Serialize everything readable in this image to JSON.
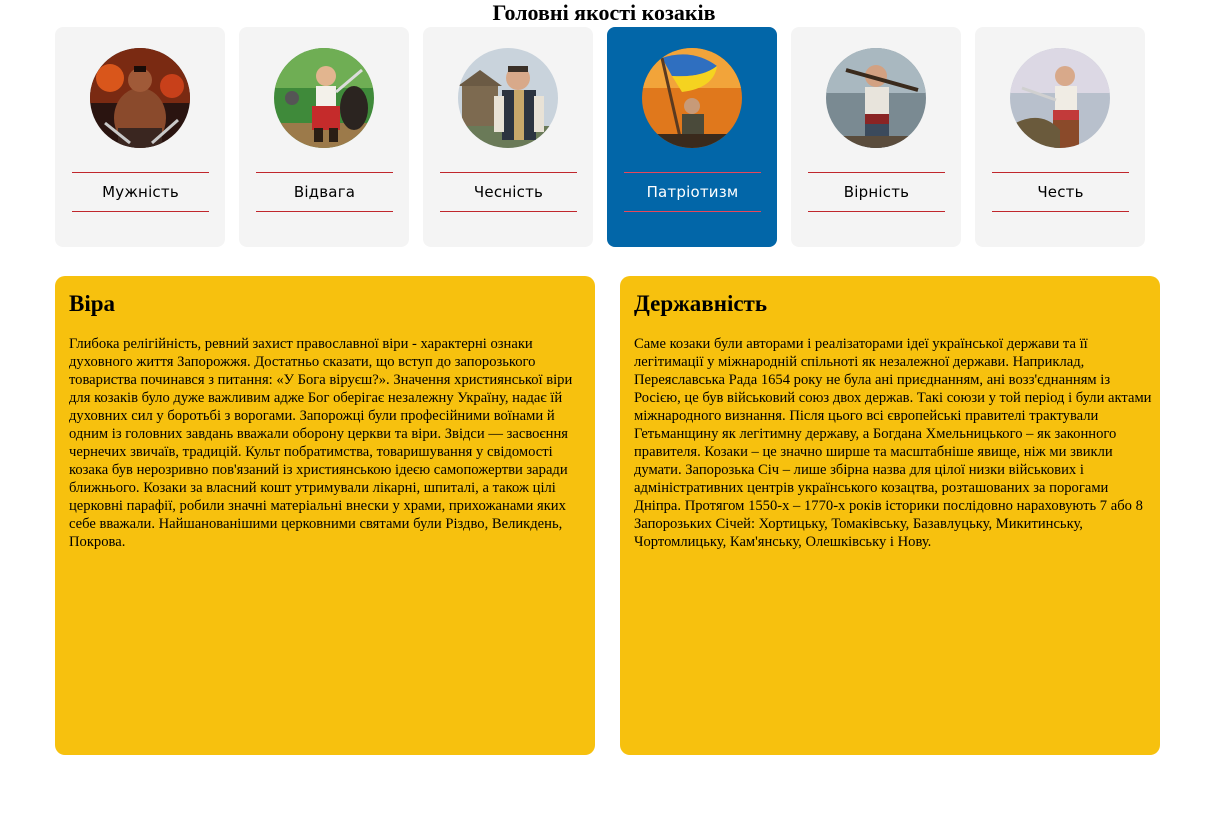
{
  "title": "Головні якості козаків",
  "qualities": [
    {
      "label": "Мужність",
      "icon": "warrior-portrait",
      "active": false
    },
    {
      "label": "Відвага",
      "icon": "cossack-warrior-portrait",
      "active": false
    },
    {
      "label": "Чесність",
      "icon": "cossack-at-fortress-portrait",
      "active": false
    },
    {
      "label": "Патріотизм",
      "icon": "flag-bearer-portrait",
      "active": true
    },
    {
      "label": "Вірність",
      "icon": "cossack-with-musket-portrait",
      "active": false
    },
    {
      "label": "Честь",
      "icon": "cossack-with-sabre-portrait",
      "active": false
    }
  ],
  "panels": [
    {
      "title": "Віра",
      "text": "Глибока релігійність, ревний захист православної віри - характерні ознаки духовного життя Запорожжя. Достатньо сказати, що вступ до запорозького товариства починався з питання: «У Бога віруєш?». Значення християнської віри для козаків було дуже важливим адже Бог оберігає незалежну Україну, надає їй духовних сил у боротьбі з ворогами. Запорожці були професійними воїнами й одним із головних завдань вважали оборону церкви та віри. Звідси — засвоєння чернечих звичаїв, традицій. Культ побратимства, товаришування у свідомості козака був нерозривно пов'язаний із християнською ідеєю самопожертви заради ближнього. Козаки за власний кошт утримували лікарні, шпиталі, а також цілі церковні парафії, робили значні матеріальні внески у храми, прихожанами яких себе вважали. Найшанованішими церковними святами були Різдво, Великдень, Покрова."
    },
    {
      "title": "Державність",
      "text": "Саме козаки були авторами і реалізаторами ідеї української держави та її легітимації у міжнародній спільноті як незалежної держави. Наприклад, Переяславська Рада 1654 року не була ані приєднанням, ані возз'єднанням із Росією, це був військовий союз двох держав. Такі союзи у той період і були актами міжнародного визнання. Після цього всі європейські правителі трактували Гетьманщину як легітимну державу, а Богдана Хмельницького – як законного правителя. Козаки – це значно ширше та масштабніше явище, ніж ми звикли думати. Запорозька Січ – лише збірна назва для цілої низки військових і адміністративних центрів українського козацтва, розташованих за порогами Дніпра. Протягом 1550-х – 1770-х років історики послідовно нараховують 7 або 8 Запорозьких Січей: Хортицьку, Томаківську, Базавлуцьку, Микитинську, Чортомлицьку, Кам'янську, Олешківську і Нову."
    }
  ],
  "colors": {
    "card_bg": "#f4f4f4",
    "active_card_bg": "#0266a8",
    "divider": "#c0262c",
    "panel_bg": "#f7c10e"
  }
}
